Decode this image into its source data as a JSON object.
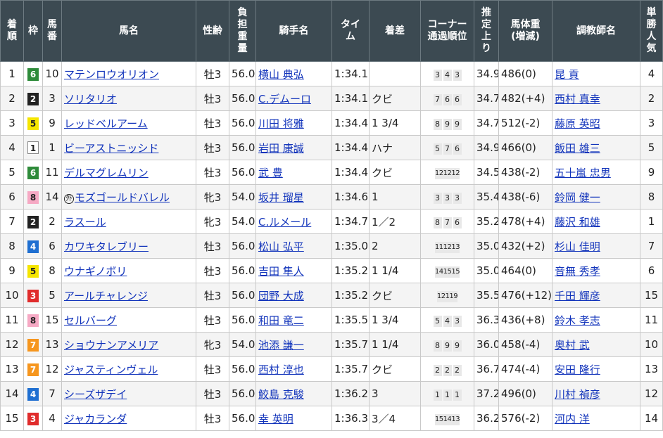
{
  "headers": {
    "rank": "着\n順",
    "waku": "枠",
    "umaban": "馬\n番",
    "horse": "馬名",
    "sexage": "性齢",
    "weight": "負\n担\n重\n量",
    "jockey": "騎手名",
    "time": "タイ\nム",
    "margin": "着差",
    "corner": "コーナー\n通過順位",
    "last3f": "推\n定\n上\nり",
    "bodyweight": "馬体重\n(増減)",
    "trainer": "調教師名",
    "popularity": "単\n勝\n人\n気"
  },
  "rows": [
    {
      "rank": "1",
      "waku": "6",
      "umaban": "10",
      "mark": "",
      "horse": "マテンロウオリオン",
      "sexage": "牡3",
      "weight": "56.0",
      "jockey": "横山 典弘",
      "time": "1:34.1",
      "margin": "",
      "corner": [
        "3",
        "4",
        "3"
      ],
      "last3f": "34.9",
      "bodyweight": "486(0)",
      "trainer": "昆 貢",
      "popularity": "4"
    },
    {
      "rank": "2",
      "waku": "2",
      "umaban": "3",
      "mark": "",
      "horse": "ソリタリオ",
      "sexage": "牡3",
      "weight": "56.0",
      "jockey": "C.デムーロ",
      "time": "1:34.1",
      "margin": "クビ",
      "corner": [
        "7",
        "6",
        "6"
      ],
      "last3f": "34.7",
      "bodyweight": "482(+4)",
      "trainer": "西村 真幸",
      "popularity": "2"
    },
    {
      "rank": "3",
      "waku": "5",
      "umaban": "9",
      "mark": "",
      "horse": "レッドベルアーム",
      "sexage": "牡3",
      "weight": "56.0",
      "jockey": "川田 将雅",
      "time": "1:34.4",
      "margin": "1 3/4",
      "corner": [
        "8",
        "9",
        "9"
      ],
      "last3f": "34.7",
      "bodyweight": "512(-2)",
      "trainer": "藤原 英昭",
      "popularity": "3"
    },
    {
      "rank": "4",
      "waku": "1",
      "umaban": "1",
      "mark": "",
      "horse": "ビーアストニッシド",
      "sexage": "牡3",
      "weight": "56.0",
      "jockey": "岩田 康誠",
      "time": "1:34.4",
      "margin": "ハナ",
      "corner": [
        "5",
        "7",
        "6"
      ],
      "last3f": "34.9",
      "bodyweight": "466(0)",
      "trainer": "飯田 雄三",
      "popularity": "5"
    },
    {
      "rank": "5",
      "waku": "6",
      "umaban": "11",
      "mark": "",
      "horse": "デルマグレムリン",
      "sexage": "牡3",
      "weight": "56.0",
      "jockey": "武 豊",
      "time": "1:34.4",
      "margin": "クビ",
      "corner": [
        "12",
        "12",
        "12"
      ],
      "last3f": "34.5",
      "bodyweight": "438(-2)",
      "trainer": "五十嵐 忠男",
      "popularity": "9"
    },
    {
      "rank": "6",
      "waku": "8",
      "umaban": "14",
      "mark": "外",
      "horse": "モズゴールドバレル",
      "sexage": "牝3",
      "weight": "54.0",
      "jockey": "坂井 瑠星",
      "time": "1:34.6",
      "margin": "1",
      "corner": [
        "3",
        "3",
        "3"
      ],
      "last3f": "35.4",
      "bodyweight": "438(-6)",
      "trainer": "鈴岡 健一",
      "popularity": "8"
    },
    {
      "rank": "7",
      "waku": "2",
      "umaban": "2",
      "mark": "",
      "horse": "ラスール",
      "sexage": "牝3",
      "weight": "54.0",
      "jockey": "C.ルメール",
      "time": "1:34.7",
      "margin": "1／2",
      "corner": [
        "8",
        "7",
        "6"
      ],
      "last3f": "35.2",
      "bodyweight": "478(+4)",
      "trainer": "藤沢 和雄",
      "popularity": "1"
    },
    {
      "rank": "8",
      "waku": "4",
      "umaban": "6",
      "mark": "",
      "horse": "カワキタレブリー",
      "sexage": "牡3",
      "weight": "56.0",
      "jockey": "松山 弘平",
      "time": "1:35.0",
      "margin": "2",
      "corner": [
        "11",
        "12",
        "13"
      ],
      "last3f": "35.0",
      "bodyweight": "432(+2)",
      "trainer": "杉山 佳明",
      "popularity": "7"
    },
    {
      "rank": "9",
      "waku": "5",
      "umaban": "8",
      "mark": "",
      "horse": "ウナギノボリ",
      "sexage": "牡3",
      "weight": "56.0",
      "jockey": "吉田 隼人",
      "time": "1:35.2",
      "margin": "1 1/4",
      "corner": [
        "14",
        "15",
        "15"
      ],
      "last3f": "35.0",
      "bodyweight": "464(0)",
      "trainer": "音無 秀孝",
      "popularity": "6"
    },
    {
      "rank": "10",
      "waku": "3",
      "umaban": "5",
      "mark": "",
      "horse": "アールチャレンジ",
      "sexage": "牡3",
      "weight": "56.0",
      "jockey": "団野 大成",
      "time": "1:35.2",
      "margin": "クビ",
      "corner": [
        "12",
        "11",
        "9"
      ],
      "last3f": "35.5",
      "bodyweight": "476(+12)",
      "trainer": "千田 輝彦",
      "popularity": "15"
    },
    {
      "rank": "11",
      "waku": "8",
      "umaban": "15",
      "mark": "",
      "horse": "セルバーグ",
      "sexage": "牡3",
      "weight": "56.0",
      "jockey": "和田 竜二",
      "time": "1:35.5",
      "margin": "1 3/4",
      "corner": [
        "5",
        "4",
        "3"
      ],
      "last3f": "36.3",
      "bodyweight": "436(+8)",
      "trainer": "鈴木 孝志",
      "popularity": "11"
    },
    {
      "rank": "12",
      "waku": "7",
      "umaban": "13",
      "mark": "",
      "horse": "ショウナンアメリア",
      "sexage": "牝3",
      "weight": "54.0",
      "jockey": "池添 謙一",
      "time": "1:35.7",
      "margin": "1 1/4",
      "corner": [
        "8",
        "9",
        "9"
      ],
      "last3f": "36.0",
      "bodyweight": "458(-4)",
      "trainer": "奥村 武",
      "popularity": "10"
    },
    {
      "rank": "13",
      "waku": "7",
      "umaban": "12",
      "mark": "",
      "horse": "ジャスティンヴェル",
      "sexage": "牡3",
      "weight": "56.0",
      "jockey": "西村 淳也",
      "time": "1:35.7",
      "margin": "クビ",
      "corner": [
        "2",
        "2",
        "2"
      ],
      "last3f": "36.7",
      "bodyweight": "474(-4)",
      "trainer": "安田 隆行",
      "popularity": "13"
    },
    {
      "rank": "14",
      "waku": "4",
      "umaban": "7",
      "mark": "",
      "horse": "シーズザデイ",
      "sexage": "牡3",
      "weight": "56.0",
      "jockey": "鮫島 克駿",
      "time": "1:36.2",
      "margin": "3",
      "corner": [
        "1",
        "1",
        "1"
      ],
      "last3f": "37.2",
      "bodyweight": "496(0)",
      "trainer": "川村 禎彦",
      "popularity": "12"
    },
    {
      "rank": "15",
      "waku": "3",
      "umaban": "4",
      "mark": "",
      "horse": "ジャカランダ",
      "sexage": "牡3",
      "weight": "56.0",
      "jockey": "幸 英明",
      "time": "1:36.3",
      "margin": "3／4",
      "corner": [
        "15",
        "14",
        "13"
      ],
      "last3f": "36.2",
      "bodyweight": "576(-2)",
      "trainer": "河内 洋",
      "popularity": "14"
    }
  ]
}
